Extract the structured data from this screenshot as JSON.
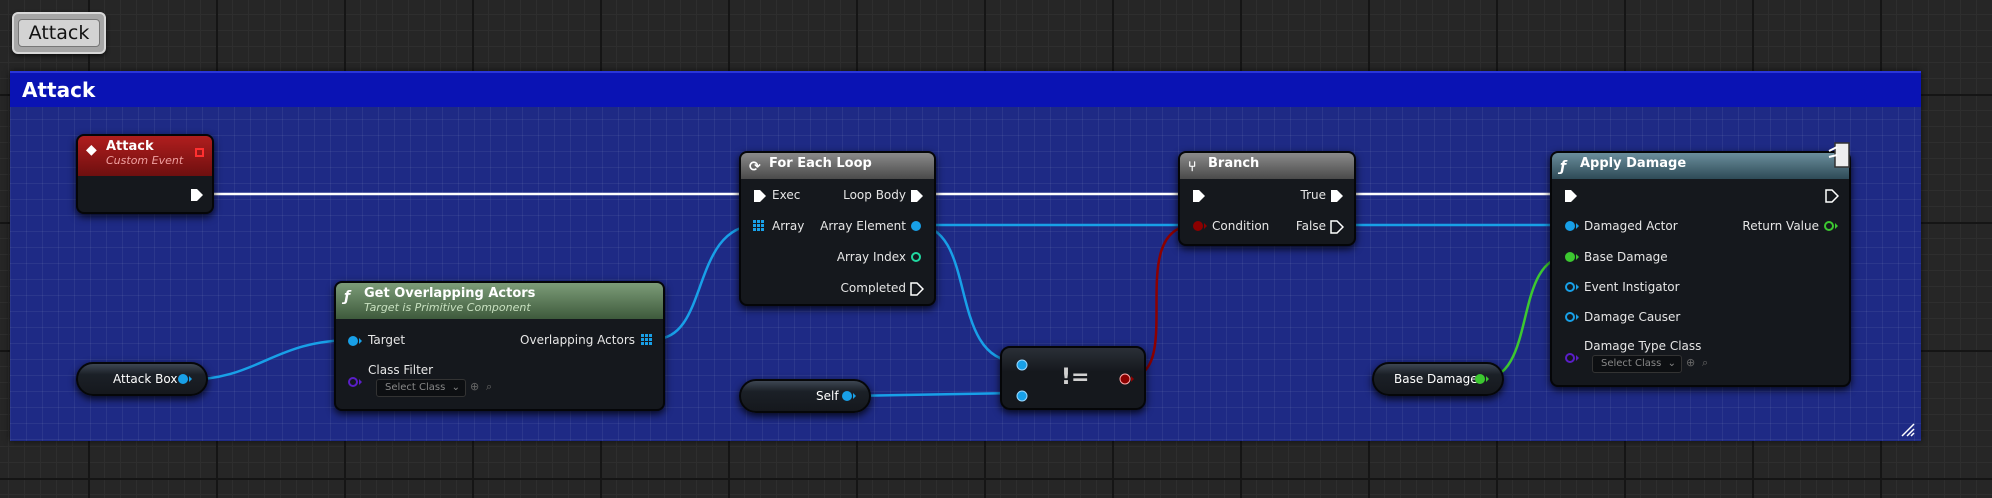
{
  "title_button": "Attack",
  "comment": {
    "title": "Attack"
  },
  "nodes": {
    "custom_event": {
      "title": "Attack",
      "subtitle": "Custom Event"
    },
    "get_overlapping": {
      "title": "Get Overlapping Actors",
      "subtitle": "Target is Primitive Component",
      "pins": {
        "target": "Target",
        "class_filter": "Class Filter",
        "overlapping_actors": "Overlapping Actors"
      },
      "class_select": "Select Class"
    },
    "for_each": {
      "title": "For Each Loop",
      "pins": {
        "exec": "Exec",
        "array": "Array",
        "loop_body": "Loop Body",
        "array_element": "Array Element",
        "array_index": "Array Index",
        "completed": "Completed"
      }
    },
    "not_equal": {
      "operator": "!="
    },
    "branch": {
      "title": "Branch",
      "pins": {
        "condition": "Condition",
        "true": "True",
        "false": "False"
      }
    },
    "apply_damage": {
      "title": "Apply Damage",
      "pins": {
        "damaged_actor": "Damaged Actor",
        "base_damage": "Base Damage",
        "event_instigator": "Event Instigator",
        "damage_causer": "Damage Causer",
        "damage_type_class": "Damage Type Class",
        "return_value": "Return Value"
      },
      "class_select": "Select Class"
    },
    "attack_box": {
      "label": "Attack Box"
    },
    "self": {
      "label": "Self"
    },
    "base_damage_var": {
      "label": "Base Damage"
    }
  },
  "colors": {
    "object_pin": "#18a0e8",
    "float_pin": "#3cc830",
    "bool_pin": "#8c0000",
    "class_pin": "#5a1ec8",
    "exec": "#ffffff",
    "event_header": "#8c1414",
    "function_header": "#486872",
    "pure_function_header": "#5a7a58",
    "comment_header": "#0a13b4"
  }
}
